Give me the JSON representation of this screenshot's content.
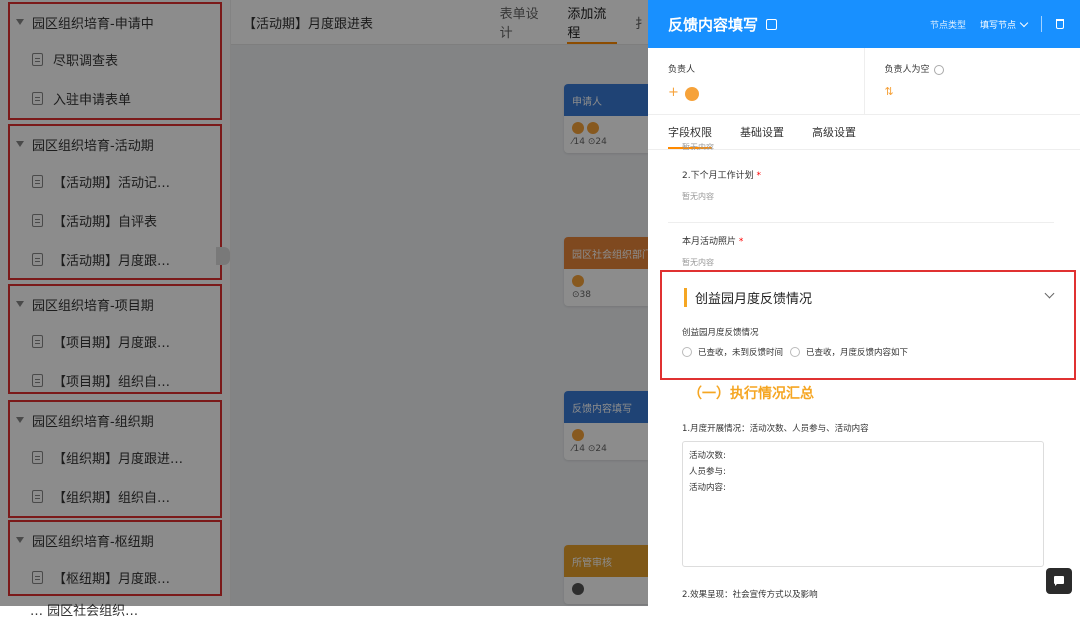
{
  "sidebar": {
    "groups": [
      {
        "title": "园区组织培育-申请中",
        "items": [
          "尽职调查表",
          "入驻申请表单"
        ]
      },
      {
        "title": "园区组织培育-活动期",
        "items": [
          "【活动期】活动记…",
          "【活动期】自评表",
          "【活动期】月度跟…"
        ]
      },
      {
        "title": "园区组织培育-项目期",
        "items": [
          "【项目期】月度跟…",
          "【项目期】组织自…"
        ]
      },
      {
        "title": "园区组织培育-组织期",
        "items": [
          "【组织期】月度跟进…",
          "【组织期】组织自…"
        ]
      },
      {
        "title": "园区组织培育-枢纽期",
        "items": [
          "【枢纽期】月度跟…"
        ]
      }
    ],
    "cut_item": "… 园区社会组织…"
  },
  "middle": {
    "title": "【活动期】月度跟进表",
    "tabs": [
      "表单设计",
      "添加流程",
      "扌"
    ],
    "nodes": [
      {
        "title": "申请人",
        "meta": "⁄14 ⊙24",
        "color": "#3a7bd5"
      },
      {
        "title": "园区社会组织部门",
        "meta": "⊙38",
        "color": "#e8863a"
      },
      {
        "title": "反馈内容填写",
        "meta": "⁄14 ⊙24",
        "color": "#3a7bd5"
      },
      {
        "title": "所管审核",
        "meta": "",
        "color": "#e8a02a"
      }
    ]
  },
  "panel": {
    "title": "反馈内容填写",
    "node_type_label": "节点类型",
    "node_type_value": "填写节点",
    "owner_label": "负责人",
    "owner_empty_label": "负责人为空",
    "tabs": [
      "字段权限",
      "基础设置",
      "高级设置"
    ],
    "scrolled_text": "暂无内容",
    "field_next_plan": "2.下个月工作计划",
    "field_photos": "本月活动照片",
    "empty_text": "暂无内容",
    "section_title": "创益园月度反馈情况",
    "radio_label": "创益园月度反馈情况",
    "radio_options": [
      "已查收，未到反馈时间",
      "已查收，月度反馈内容如下"
    ],
    "summary_title": "（一）执行情况汇总",
    "question1": "1.月度开展情况：活动次数、人员参与、活动内容",
    "textarea_value": "活动次数:\n人员参与:\n活动内容:",
    "question2": "2.效果呈现：社会宣传方式以及影响"
  },
  "colors": {
    "primary": "#1890ff",
    "accent": "#f5a623",
    "highlight": "#e03131"
  }
}
